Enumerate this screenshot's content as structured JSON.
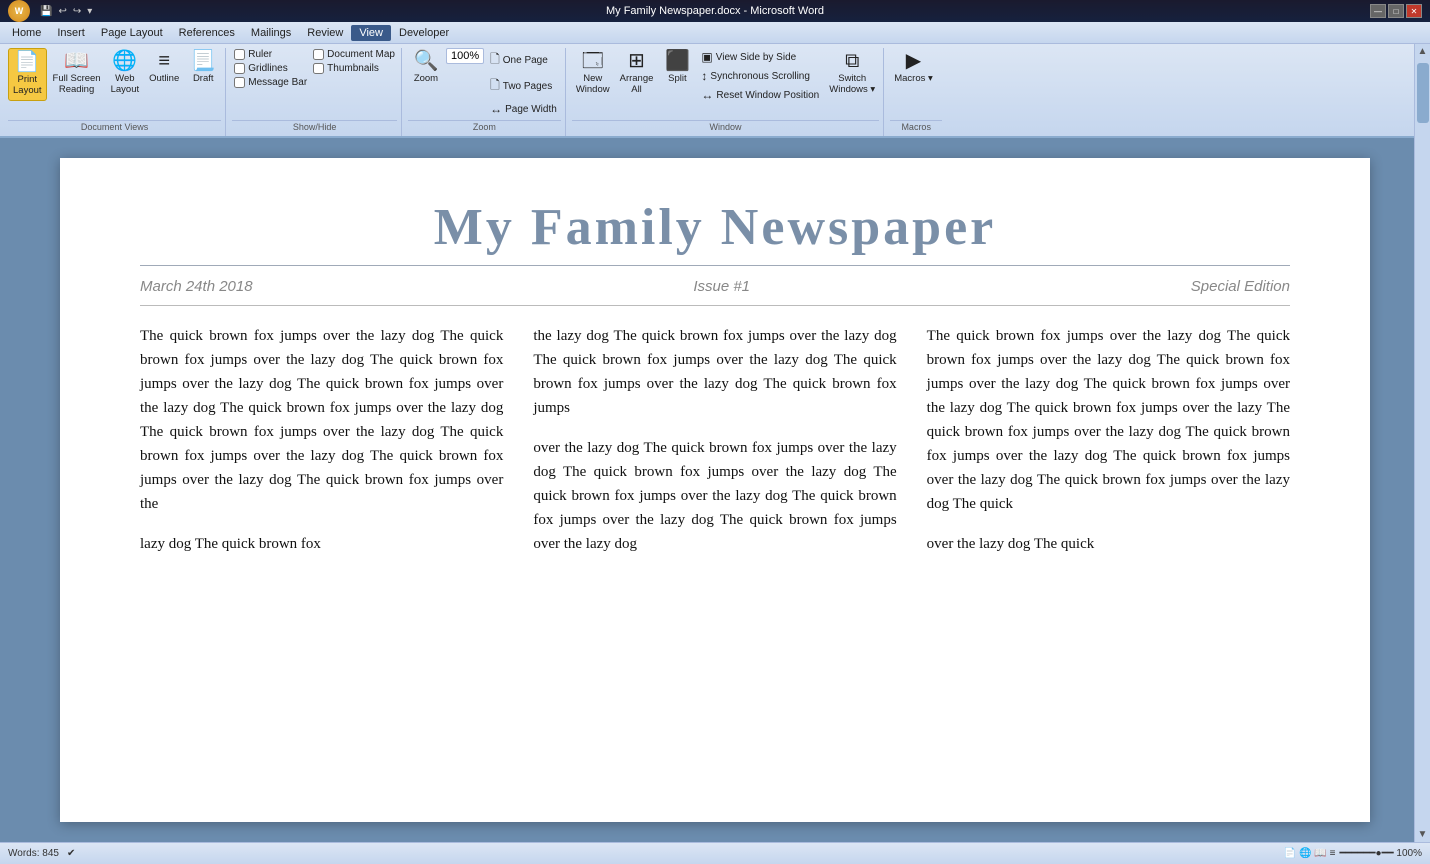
{
  "titlebar": {
    "title": "My Family Newspaper.docx - Microsoft Word",
    "office_icon": "W",
    "quick_access": [
      "💾",
      "↩",
      "↪"
    ],
    "controls": [
      "—",
      "□",
      "✕"
    ]
  },
  "menubar": {
    "items": [
      "Home",
      "Insert",
      "Page Layout",
      "References",
      "Mailings",
      "Review",
      "View",
      "Developer"
    ],
    "active": "View"
  },
  "ribbon": {
    "groups": [
      {
        "label": "Document Views",
        "buttons": [
          {
            "id": "print-layout",
            "icon": "📄",
            "label": "Print\nLayout",
            "active": true
          },
          {
            "id": "full-screen-reading",
            "icon": "📖",
            "label": "Full Screen\nReading",
            "active": false
          },
          {
            "id": "web-layout",
            "icon": "🌐",
            "label": "Web\nLayout",
            "active": false
          },
          {
            "id": "outline",
            "icon": "≡",
            "label": "Outline",
            "active": false
          },
          {
            "id": "draft",
            "icon": "📃",
            "label": "Draft",
            "active": false
          }
        ]
      },
      {
        "label": "Show/Hide",
        "checkboxes": [
          {
            "id": "ruler",
            "label": "Ruler",
            "checked": false
          },
          {
            "id": "gridlines",
            "label": "Gridlines",
            "checked": false
          },
          {
            "id": "message-bar",
            "label": "Message Bar",
            "checked": false
          },
          {
            "id": "document-map",
            "label": "Document Map",
            "checked": false
          },
          {
            "id": "thumbnails",
            "label": "Thumbnails",
            "checked": false
          }
        ]
      },
      {
        "label": "Zoom",
        "zoom_btn": {
          "icon": "🔍",
          "label": "Zoom"
        },
        "zoom_pct": "100%",
        "small_buttons": [
          {
            "id": "one-page",
            "icon": "🗋",
            "label": "One Page"
          },
          {
            "id": "two-pages",
            "icon": "🗋🗋",
            "label": "Two Pages"
          },
          {
            "id": "page-width",
            "icon": "↔",
            "label": "Page Width"
          }
        ]
      },
      {
        "label": "Window",
        "buttons": [
          {
            "id": "new-window",
            "icon": "🗔",
            "label": "New\nWindow"
          },
          {
            "id": "arrange-all",
            "icon": "⊞",
            "label": "Arrange\nAll"
          },
          {
            "id": "split",
            "icon": "⬛",
            "label": "Split"
          }
        ],
        "small_buttons": [
          {
            "id": "view-side-by-side",
            "icon": "▣",
            "label": "View Side by Side"
          },
          {
            "id": "synchronous-scrolling",
            "icon": "↕",
            "label": "Synchronous Scrolling"
          },
          {
            "id": "reset-window-position",
            "icon": "↔",
            "label": "Reset Window Position"
          },
          {
            "id": "switch-windows",
            "icon": "⧉",
            "label": "Switch Windows ▾"
          }
        ]
      },
      {
        "label": "Macros",
        "buttons": [
          {
            "id": "macros",
            "icon": "▶",
            "label": "Macros ▾"
          }
        ]
      }
    ]
  },
  "document": {
    "title": "My Family Newspaper",
    "meta": {
      "date": "March 24th 2018",
      "issue": "Issue #1",
      "edition": "Special Edition"
    },
    "columns": [
      {
        "paragraphs": [
          "The quick brown fox jumps over the lazy dog The quick brown fox jumps over the lazy dog The quick brown fox jumps over the lazy dog The quick brown fox jumps over the lazy dog The quick brown fox jumps over the lazy dog The quick brown fox jumps over the lazy dog The quick brown fox jumps over the lazy dog The quick brown fox jumps over the lazy dog The quick brown fox jumps over the",
          "lazy dog The quick brown fox"
        ]
      },
      {
        "paragraphs": [
          "the lazy dog The quick brown fox jumps over the lazy dog The quick brown fox jumps over the lazy dog The quick brown fox jumps over the lazy dog The quick brown fox jumps",
          "over the lazy dog The quick brown fox jumps over the lazy dog The quick brown fox jumps over the lazy dog The quick brown fox jumps over the lazy dog The quick brown fox jumps over the lazy dog The quick brown fox jumps over the lazy dog"
        ]
      },
      {
        "paragraphs": [
          "The quick brown fox jumps over the lazy dog The quick brown fox jumps over the lazy dog The quick brown fox jumps over the lazy dog The quick brown fox jumps over the lazy dog The quick brown fox jumps over the lazy The quick brown fox jumps over the lazy dog The quick brown fox jumps over the lazy dog The quick brown fox jumps over the lazy dog The quick brown fox jumps over the lazy dog The quick",
          "over the lazy dog The quick"
        ]
      }
    ]
  },
  "statusbar": {
    "words": "Words: 845",
    "check_icon": "✔"
  }
}
